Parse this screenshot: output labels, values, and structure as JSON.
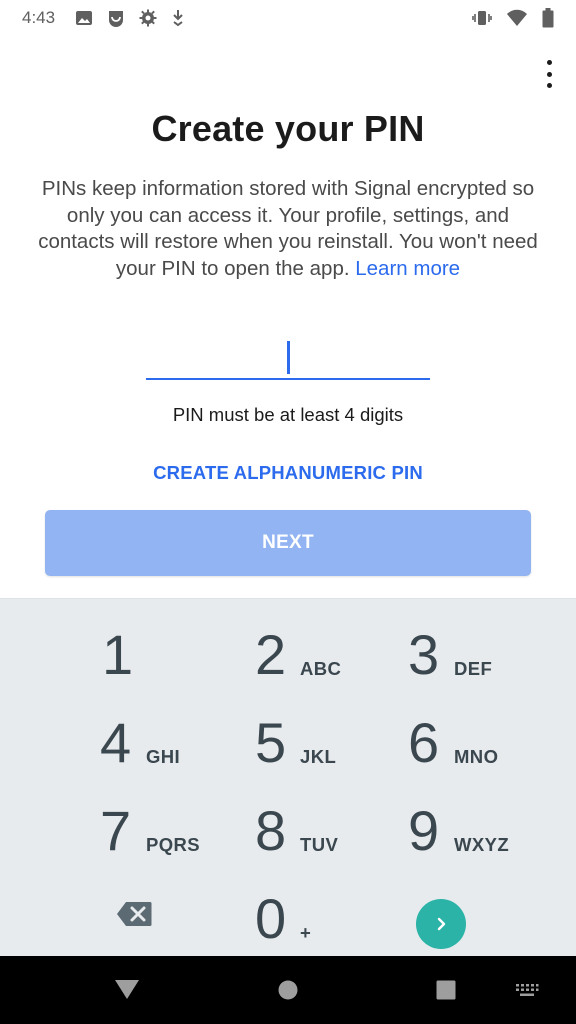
{
  "status_bar": {
    "time": "4:43",
    "left_icons": [
      "image-icon",
      "signal-notification-icon",
      "settings-icon",
      "download-icon"
    ],
    "right_icons": [
      "vibrate-icon",
      "wifi-icon",
      "battery-icon"
    ]
  },
  "header": {
    "title": "Create your PIN",
    "description": "PINs keep information stored with Signal encrypted so only you can access it. Your profile, settings, and contacts will restore when you reinstall. You won't need your PIN to open the app.",
    "learn_more": "Learn more"
  },
  "pin_input": {
    "value": "",
    "placeholder": ""
  },
  "pin_hint": "PIN must be at least 4 digits",
  "alphanumeric_label": "CREATE ALPHANUMERIC PIN",
  "next_label": "NEXT",
  "keypad": {
    "keys": [
      {
        "digit": "1",
        "letters": ""
      },
      {
        "digit": "2",
        "letters": "ABC"
      },
      {
        "digit": "3",
        "letters": "DEF"
      },
      {
        "digit": "4",
        "letters": "GHI"
      },
      {
        "digit": "5",
        "letters": "JKL"
      },
      {
        "digit": "6",
        "letters": "MNO"
      },
      {
        "digit": "7",
        "letters": "PQRS"
      },
      {
        "digit": "8",
        "letters": "TUV"
      },
      {
        "digit": "9",
        "letters": "WXYZ"
      },
      {
        "digit": "0",
        "letters": "+"
      }
    ]
  },
  "colors": {
    "accent": "#2c6bed",
    "next_button_disabled": "#93b4f2",
    "keypad_background": "#e8ebee",
    "go_button": "#2ab3a6"
  }
}
